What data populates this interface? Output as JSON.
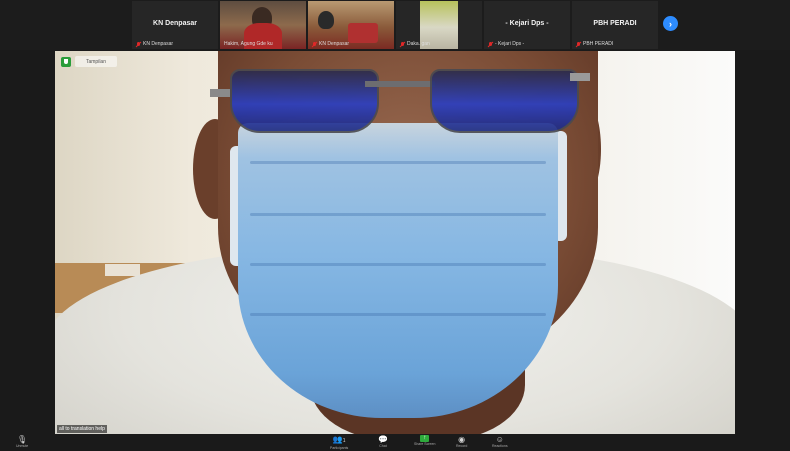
{
  "gallery": [
    {
      "kind": "name",
      "name": "KN Denpasar",
      "label": "KN Denpasar"
    },
    {
      "kind": "video",
      "label": "Hakim, Agung Gde ku"
    },
    {
      "kind": "video",
      "label": "KN Denpasar"
    },
    {
      "kind": "video",
      "label": "Daka. gan"
    },
    {
      "kind": "name",
      "name": "- Kejari Dps -",
      "label": "- Kejari Dps -"
    },
    {
      "kind": "name",
      "name": "PBH PERADI",
      "label": "PBH PERADI"
    }
  ],
  "next_page_icon": "chevron-right-icon",
  "main_video": {
    "view_button": "Tampilan",
    "speaker_label": "all to translation help"
  },
  "toolbar": {
    "left": {
      "icon": "mic-icon",
      "label": "Unmute"
    },
    "participants": {
      "icon": "participants-icon",
      "label": "Participants",
      "count": "1"
    },
    "chat": {
      "icon": "chat-icon",
      "label": "Chat"
    },
    "share": {
      "icon": "share-screen-icon",
      "label": "Share Screen"
    },
    "record": {
      "icon": "record-icon",
      "label": "Record"
    },
    "reactions": {
      "icon": "reactions-icon",
      "label": "Reactions"
    }
  },
  "colors": {
    "accent": "#2d8cff",
    "muted": "#e02828",
    "share": "#2eaa3c"
  }
}
